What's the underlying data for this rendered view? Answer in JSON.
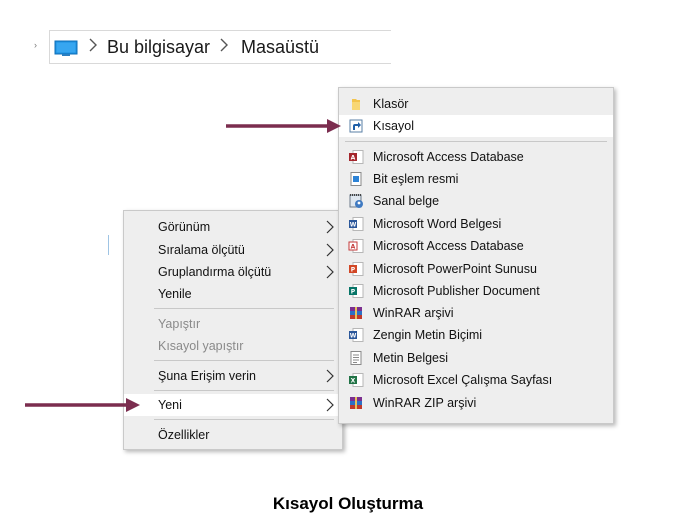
{
  "address_bar": {
    "crumbs": [
      "Bu bilgisayar",
      "Masaüstü"
    ]
  },
  "context_menu": {
    "items": {
      "gorunum": "Görünüm",
      "siralama": "Sıralama ölçütü",
      "gruplandirma": "Gruplandırma ölçütü",
      "yenile": "Yenile",
      "yapistir": "Yapıştır",
      "kisayol_yapistir": "Kısayol yapıştır",
      "erisim": "Şuna Erişim verin",
      "yeni": "Yeni",
      "ozellikler": "Özellikler"
    }
  },
  "new_submenu": {
    "items": [
      {
        "label": "Klasör",
        "icon": "folder-icon"
      },
      {
        "label": "Kısayol",
        "icon": "shortcut-icon"
      },
      {
        "label": "Microsoft Access Database",
        "icon": "access-icon"
      },
      {
        "label": "Bit eşlem resmi",
        "icon": "bitmap-icon"
      },
      {
        "label": "Sanal belge",
        "icon": "contact-icon"
      },
      {
        "label": "Microsoft Word Belgesi",
        "icon": "word-icon"
      },
      {
        "label": "Microsoft Access Database",
        "icon": "access-icon"
      },
      {
        "label": "Microsoft PowerPoint Sunusu",
        "icon": "powerpoint-icon"
      },
      {
        "label": "Microsoft Publisher Document",
        "icon": "publisher-icon"
      },
      {
        "label": "WinRAR arşivi",
        "icon": "winrar-icon"
      },
      {
        "label": "Zengin Metin Biçimi",
        "icon": "rtf-icon"
      },
      {
        "label": "Metin Belgesi",
        "icon": "text-document-icon"
      },
      {
        "label": "Microsoft Excel Çalışma Sayfası",
        "icon": "excel-icon"
      },
      {
        "label": "WinRAR ZIP arşivi",
        "icon": "winrar-zip-icon"
      }
    ]
  },
  "caption": "Kısayol Oluşturma",
  "colors": {
    "arrow": "#7b2d4f",
    "menu_bg": "#eeeeee",
    "menu_hover": "#ffffff"
  }
}
